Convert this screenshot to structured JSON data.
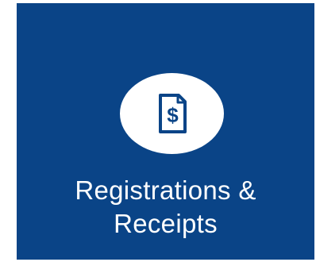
{
  "tile": {
    "label_line1": "Registrations &",
    "label_line2": "Receipts",
    "icon": "dollar-document-icon",
    "icon_glyph": "$",
    "background_color": "#0a4487",
    "icon_background_color": "#ffffff",
    "text_color": "#ffffff"
  }
}
